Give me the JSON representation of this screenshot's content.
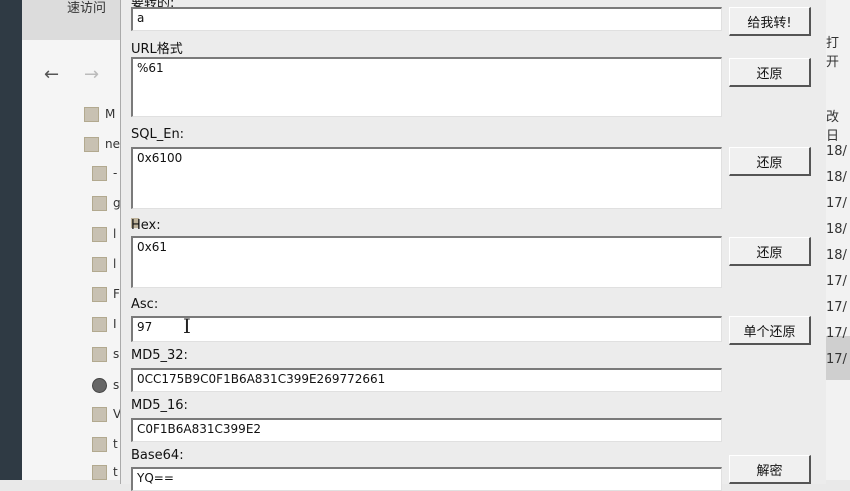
{
  "background": {
    "tab_label": "速访问",
    "nav": {
      "back_icon": "arrow-left-icon",
      "forward_icon": "arrow-right-icon"
    },
    "tree_items": [
      {
        "label": "M",
        "icon": "folder-icon"
      },
      {
        "label": "ne",
        "icon": "folder-icon"
      },
      {
        "label": "-",
        "icon": "folder-icon"
      },
      {
        "label": "g",
        "icon": "folder-icon"
      },
      {
        "label": "l",
        "icon": "folder-icon"
      },
      {
        "label": "l",
        "icon": "folder-icon"
      },
      {
        "label": "F",
        "icon": "folder-icon"
      },
      {
        "label": "I",
        "icon": "folder-icon"
      },
      {
        "label": "s",
        "icon": "folder-icon"
      },
      {
        "label": "s",
        "icon": "disk-icon"
      },
      {
        "label": "V",
        "icon": "folder-icon"
      },
      {
        "label": "t",
        "icon": "folder-icon"
      },
      {
        "label": "t",
        "icon": "folder-icon"
      }
    ],
    "right_column": [
      "打开",
      "改日",
      "18/",
      "18/",
      "17/",
      "18/",
      "18/",
      "17/",
      "17/",
      "17/",
      "17/"
    ]
  },
  "converter": {
    "input": {
      "label": "要转的:",
      "value": "a",
      "button": "给我转!"
    },
    "url": {
      "label": "URL格式",
      "value": "%61",
      "button": "还原"
    },
    "sql": {
      "label": "SQL_En:",
      "value": "0x6100",
      "button": "还原"
    },
    "hex": {
      "label": "Hex:",
      "value": "0x61",
      "button": "还原"
    },
    "asc": {
      "label": "Asc:",
      "value": "97",
      "button": "单个还原"
    },
    "md5_32": {
      "label": "MD5_32:",
      "value": "0CC175B9C0F1B6A831C399E269772661"
    },
    "md5_16": {
      "label": "MD5_16:",
      "value": "C0F1B6A831C399E2"
    },
    "base64": {
      "label": "Base64:",
      "value": "YQ==",
      "button": "解密"
    }
  }
}
